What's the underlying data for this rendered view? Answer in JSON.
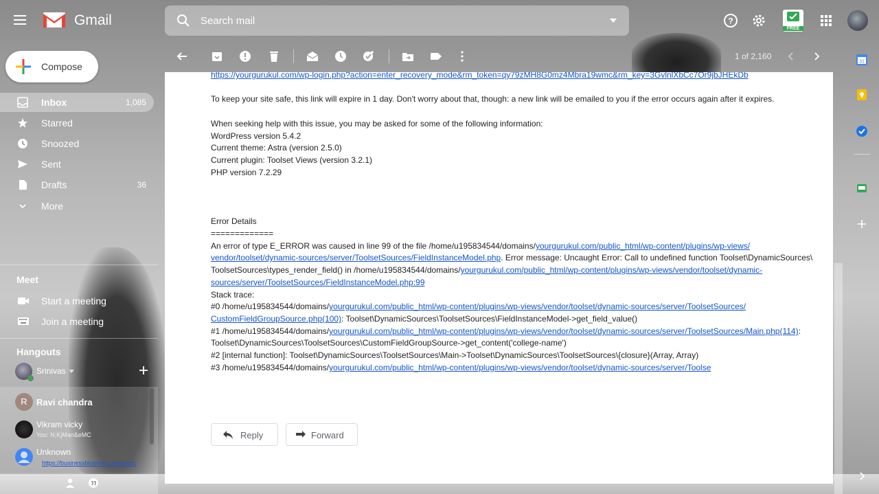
{
  "app": {
    "logo_text": "Gmail",
    "search_placeholder": "Search mail",
    "compose_label": "Compose",
    "free_badge": "FREE"
  },
  "nav": [
    {
      "label": "Inbox",
      "count": "1,085"
    },
    {
      "label": "Starred",
      "count": ""
    },
    {
      "label": "Snoozed",
      "count": ""
    },
    {
      "label": "Sent",
      "count": ""
    },
    {
      "label": "Drafts",
      "count": "36"
    },
    {
      "label": "More",
      "count": ""
    }
  ],
  "meet": {
    "title": "Meet",
    "start": "Start a meeting",
    "join": "Join a meeting"
  },
  "hangouts": {
    "title": "Hangouts",
    "user": "Srinivas",
    "contacts": [
      {
        "name": "Ravi chandra",
        "initial": "R",
        "sub": ""
      },
      {
        "name": "Vikram vicky",
        "initial": "",
        "sub": "You: N;KjMan&eMC"
      },
      {
        "name": "Unknown",
        "initial": "",
        "sub": "https://businessbloomer.com/wooc"
      }
    ]
  },
  "toolbar": {
    "pager": "1 of 2,160"
  },
  "message": {
    "top_link": "https://yourgurukul.com/wp-login.php?action=enter_recovery_mode&rm_token=qy79zMH8G0mz4Mbra19wmc&rm_key=3GvlnlXbCc7Or9jbJHEkDb",
    "safe_line": "To keep your site safe, this link will expire in 1 day. Don't worry about that, though: a new link will be emailed to you if the error occurs again after it expires.",
    "seeking": "When seeking help with this issue, you may be asked for some of the following information:",
    "wp_version": "WordPress version 5.4.2",
    "theme": "Current theme: Astra (version 2.5.0)",
    "plugin": "Current plugin: Toolset Views (version 3.2.1)",
    "php": "PHP version 7.2.29",
    "error_details": "Error Details",
    "equals": "=============",
    "err1_pre": "An error of type E_ERROR was caused in line 99 of the file /home/u195834544/domains/",
    "err1_link": "yourgurukul.com/public_html/wp-content/plugins/wp-views/",
    "err2_link": "vendor/toolset/dynamic-sources/server/ToolsetSources/FieldInstanceModel.php",
    "err2_post": ". Error message: Uncaught Error: Call to undefined function Toolset\\DynamicSources\\",
    "err3_pre": "ToolsetSources\\types_render_field() in /home/u195834544/domains/",
    "err3_link": "yourgurukul.com/public_html/wp-content/plugins/wp-views/vendor/toolset/dynamic-",
    "err4_link": "sources/server/ToolsetSources/FieldInstanceModel.php:99",
    "stack": "Stack trace:",
    "s0_pre": "#0 /home/u195834544/domains/",
    "s0_link": "yourgurukul.com/public_html/wp-content/plugins/wp-views/vendor/toolset/dynamic-sources/server/ToolsetSources/",
    "s0b_link": "CustomFieldGroupSource.php(100)",
    "s0b_post": ": Toolset\\DynamicSources\\ToolsetSources\\FieldInstanceModel->get_field_value()",
    "s1_pre": "#1 /home/u195834544/domains/",
    "s1_link": "yourgurukul.com/public_html/wp-content/plugins/wp-views/vendor/toolset/dynamic-sources/server/ToolsetSources/Main.php(114)",
    "s1_post": ":",
    "s1b": "Toolset\\DynamicSources\\ToolsetSources\\CustomFieldGroupSource->get_content('college-name')",
    "s2": "#2 [internal function]: Toolset\\DynamicSources\\ToolsetSources\\Main->Toolset\\DynamicSources\\ToolsetSources\\{closure}(Array, Array)",
    "s3_pre": "#3 /home/u195834544/domains/",
    "s3_link": "yourgurukul.com/public_html/wp-content/plugins/wp-views/vendor/toolset/dynamic-sources/server/Toolse",
    "reply": "Reply",
    "forward": "Forward"
  },
  "colors": {
    "link": "#1155cc",
    "accent_green": "#34a853",
    "gmail_red": "#ea4335"
  }
}
